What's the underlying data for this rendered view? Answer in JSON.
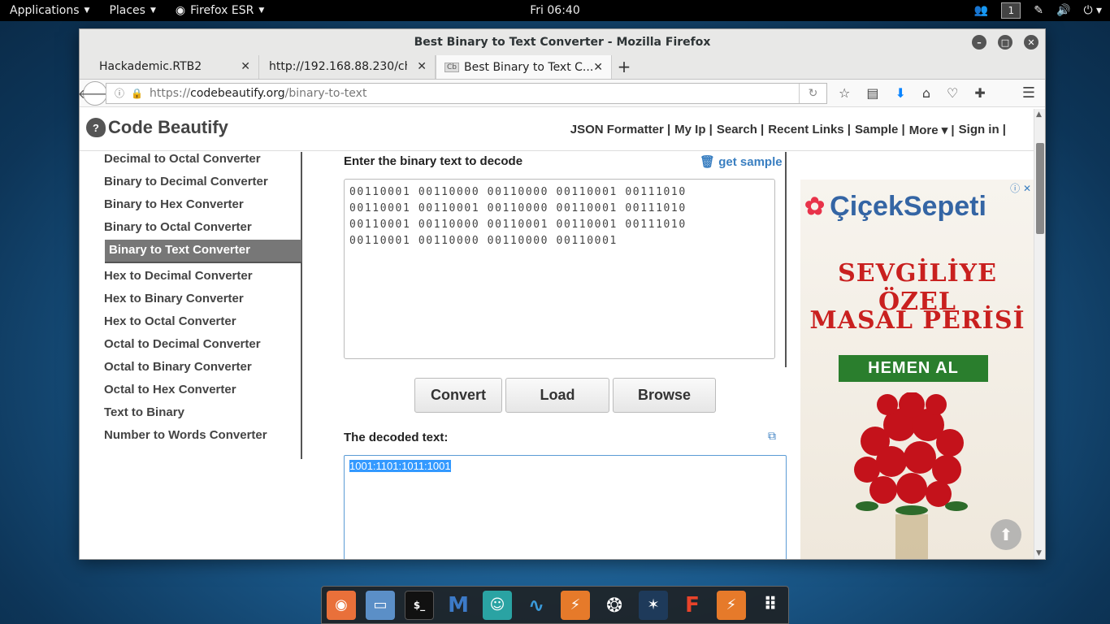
{
  "top_panel": {
    "applications": "Applications",
    "places": "Places",
    "firefox": "Firefox ESR",
    "clock": "Fri 06:40",
    "workspace": "1"
  },
  "window": {
    "title": "Best Binary to Text Converter - Mozilla Firefox",
    "tabs": [
      {
        "label": "Hackademic.RTB2"
      },
      {
        "label": "http://192.168.88.230/ch..."
      },
      {
        "label": "Best Binary to Text C...",
        "favicon": "Cb"
      }
    ],
    "url": {
      "scheme": "https://",
      "host": "codebeautify.org",
      "path": "/binary-to-text"
    }
  },
  "site": {
    "logo": "Code Beautify",
    "nav": [
      "JSON Formatter |",
      "My Ip |",
      "Search |",
      "Recent Links |",
      "Sample |",
      "More ▾ |",
      "Sign in |"
    ],
    "sidebar": [
      "Decimal to Octal Converter",
      "Binary to Decimal Converter",
      "Binary to Hex Converter",
      "Binary to Octal Converter",
      "Binary to Text Converter",
      "Hex to Decimal Converter",
      "Hex to Binary Converter",
      "Hex to Octal Converter",
      "Octal to Decimal Converter",
      "Octal to Binary Converter",
      "Octal to Hex Converter",
      "Text to Binary",
      "Number to Words Converter"
    ],
    "sidebar_active_index": 4,
    "input_label": "Enter the binary text to decode",
    "get_sample": "get sample",
    "input_value": "00110001 00110000 00110000 00110001 00111010\n00110001 00110001 00110000 00110001 00111010\n00110001 00110000 00110001 00110001 00111010\n00110001 00110000 00110000 00110001",
    "buttons": {
      "convert": "Convert",
      "load": "Load",
      "browse": "Browse"
    },
    "output_label": "The decoded text:",
    "output_value": "1001:1101:1011:1001"
  },
  "ad": {
    "brand": "ÇiçekSepeti",
    "line1": "SEVGİLİYE ÖZEL",
    "line2": "MASAL PERİSİ",
    "cta": "HEMEN AL"
  },
  "dock_icons": [
    "firefox-icon",
    "files-icon",
    "terminal-icon",
    "metasploit-icon",
    "armitage-icon",
    "wireshark-icon",
    "burpsuite-icon",
    "faraday-icon",
    "maltego-icon",
    "beef-icon",
    "zaproxy-icon",
    "show-apps-icon"
  ]
}
